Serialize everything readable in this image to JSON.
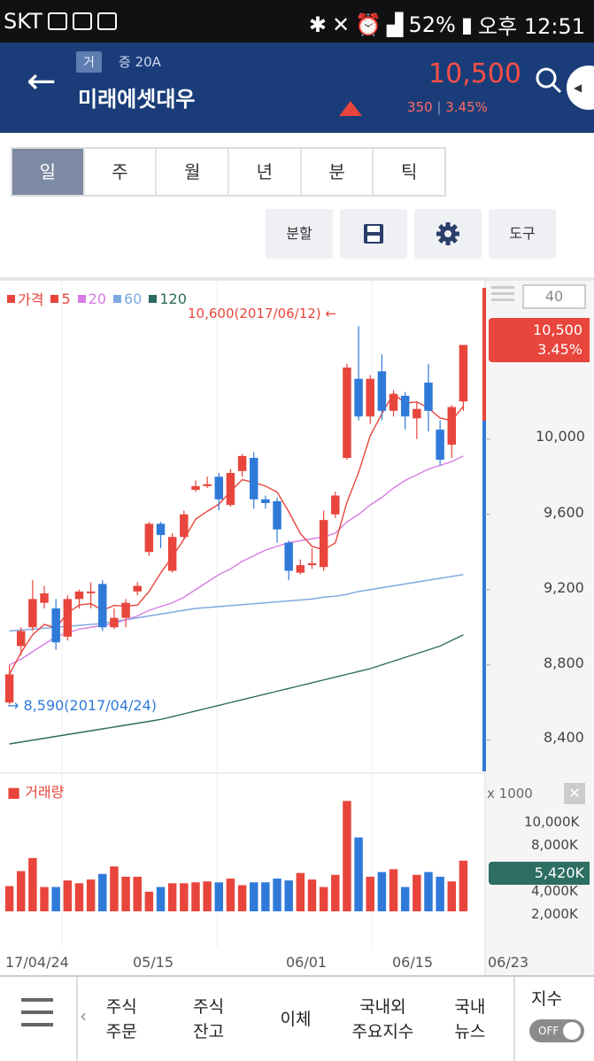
{
  "status_bar": {
    "carrier": "SKT",
    "battery": "52%",
    "time": "오후 12:51"
  },
  "header": {
    "tag": "거",
    "margin": "증 20A",
    "name": "미래에셋대우",
    "price": "10,500",
    "change_abs": "350",
    "change_pct": "3.45%"
  },
  "tabs": [
    "일",
    "주",
    "월",
    "년",
    "분",
    "틱"
  ],
  "tools": [
    "분할",
    "save-icon",
    "gear-icon",
    "도구"
  ],
  "chart": {
    "period_box": "40",
    "legend": [
      {
        "label": "가격",
        "color": "#e8453c"
      },
      {
        "label": "5",
        "color": "#e8453c"
      },
      {
        "label": "20",
        "color": "#d77ee3"
      },
      {
        "label": "60",
        "color": "#7ca8e0"
      },
      {
        "label": "120",
        "color": "#2f6b5f"
      }
    ],
    "high_note": "10,600(2017/06/12) ←",
    "low_note": "→ 8,590(2017/04/24)",
    "current_price": "10,500",
    "current_pct": "3.45%",
    "y_ticks": [
      "10,000",
      "9,600",
      "9,200",
      "8,800",
      "8,400"
    ],
    "volume_label": "거래량",
    "volume_unit": "x 1000",
    "volume_ticks": [
      "10,000K",
      "8,000K",
      "4,000K",
      "2,000K"
    ],
    "current_volume": "5,420K",
    "x_ticks": [
      "17/04/24",
      "05/15",
      "06/01",
      "06/15",
      "06/23"
    ]
  },
  "chart_data": {
    "type": "candlestick",
    "title": "",
    "xlabel": "",
    "ylabel": "",
    "ylim": [
      8300,
      10700
    ],
    "volume_ylim": [
      0,
      12500
    ],
    "candles": [
      {
        "o": 8600,
        "c": 8750,
        "h": 8800,
        "l": 8590,
        "v": 2700
      },
      {
        "o": 8900,
        "c": 8980,
        "h": 9000,
        "l": 8850,
        "v": 4300
      },
      {
        "o": 9000,
        "c": 9150,
        "h": 9250,
        "l": 8980,
        "v": 5700
      },
      {
        "o": 9130,
        "c": 9180,
        "h": 9220,
        "l": 9100,
        "v": 2600
      },
      {
        "o": 9100,
        "c": 8920,
        "h": 9150,
        "l": 8880,
        "v": 2600
      },
      {
        "o": 8950,
        "c": 9150,
        "h": 9170,
        "l": 8930,
        "v": 3300
      },
      {
        "o": 9150,
        "c": 9190,
        "h": 9200,
        "l": 9100,
        "v": 3000
      },
      {
        "o": 9190,
        "c": 9190,
        "h": 9240,
        "l": 9100,
        "v": 3400
      },
      {
        "o": 9230,
        "c": 9000,
        "h": 9250,
        "l": 8980,
        "v": 4000
      },
      {
        "o": 9000,
        "c": 9050,
        "h": 9100,
        "l": 8990,
        "v": 4800
      },
      {
        "o": 9050,
        "c": 9130,
        "h": 9150,
        "l": 9000,
        "v": 3700
      },
      {
        "o": 9190,
        "c": 9220,
        "h": 9240,
        "l": 9170,
        "v": 3700
      },
      {
        "o": 9400,
        "c": 9550,
        "h": 9560,
        "l": 9380,
        "v": 2100
      },
      {
        "o": 9550,
        "c": 9490,
        "h": 9560,
        "l": 9420,
        "v": 2600
      },
      {
        "o": 9300,
        "c": 9480,
        "h": 9500,
        "l": 9290,
        "v": 3000
      },
      {
        "o": 9480,
        "c": 9600,
        "h": 9620,
        "l": 9470,
        "v": 3000
      },
      {
        "o": 9730,
        "c": 9750,
        "h": 9780,
        "l": 9720,
        "v": 3100
      },
      {
        "o": 9750,
        "c": 9760,
        "h": 9800,
        "l": 9740,
        "v": 3200
      },
      {
        "o": 9800,
        "c": 9680,
        "h": 9820,
        "l": 9620,
        "v": 3100
      },
      {
        "o": 9650,
        "c": 9820,
        "h": 9840,
        "l": 9640,
        "v": 3500
      },
      {
        "o": 9830,
        "c": 9910,
        "h": 9920,
        "l": 9800,
        "v": 2800
      },
      {
        "o": 9900,
        "c": 9680,
        "h": 9930,
        "l": 9630,
        "v": 3100
      },
      {
        "o": 9680,
        "c": 9660,
        "h": 9700,
        "l": 9630,
        "v": 3100
      },
      {
        "o": 9670,
        "c": 9520,
        "h": 9690,
        "l": 9450,
        "v": 3500
      },
      {
        "o": 9450,
        "c": 9300,
        "h": 9460,
        "l": 9250,
        "v": 3300
      },
      {
        "o": 9290,
        "c": 9330,
        "h": 9360,
        "l": 9280,
        "v": 4100
      },
      {
        "o": 9330,
        "c": 9340,
        "h": 9420,
        "l": 9310,
        "v": 3400
      },
      {
        "o": 9320,
        "c": 9570,
        "h": 9620,
        "l": 9300,
        "v": 2600
      },
      {
        "o": 9600,
        "c": 9700,
        "h": 9720,
        "l": 9580,
        "v": 3900
      },
      {
        "o": 9900,
        "c": 10380,
        "h": 10400,
        "l": 9890,
        "v": 11800
      },
      {
        "o": 10320,
        "c": 10120,
        "h": 10600,
        "l": 10100,
        "v": 7900
      },
      {
        "o": 10120,
        "c": 10320,
        "h": 10340,
        "l": 10080,
        "v": 3700
      },
      {
        "o": 10360,
        "c": 10150,
        "h": 10450,
        "l": 10100,
        "v": 4200
      },
      {
        "o": 10150,
        "c": 10240,
        "h": 10260,
        "l": 10120,
        "v": 4500
      },
      {
        "o": 10230,
        "c": 10120,
        "h": 10250,
        "l": 10050,
        "v": 2600
      },
      {
        "o": 10110,
        "c": 10160,
        "h": 10200,
        "l": 10000,
        "v": 3900
      },
      {
        "o": 10300,
        "c": 10150,
        "h": 10400,
        "l": 10040,
        "v": 4200
      },
      {
        "o": 10050,
        "c": 9890,
        "h": 10100,
        "l": 9860,
        "v": 3700
      },
      {
        "o": 9970,
        "c": 10170,
        "h": 10180,
        "l": 9900,
        "v": 3200
      },
      {
        "o": 10200,
        "c": 10500,
        "h": 10500,
        "l": 10150,
        "v": 5420
      }
    ],
    "ma_20": [
      8800,
      8830,
      8870,
      8910,
      8950,
      8970,
      8990,
      9000,
      9010,
      9020,
      9040,
      9060,
      9090,
      9110,
      9130,
      9160,
      9200,
      9240,
      9280,
      9310,
      9350,
      9380,
      9410,
      9430,
      9450,
      9460,
      9470,
      9480,
      9500,
      9560,
      9600,
      9650,
      9690,
      9740,
      9780,
      9810,
      9840,
      9860,
      9880,
      9910
    ],
    "ma_60": [
      8980,
      8985,
      8990,
      8995,
      9000,
      9005,
      9010,
      9015,
      9020,
      9030,
      9040,
      9050,
      9060,
      9070,
      9080,
      9090,
      9100,
      9105,
      9110,
      9115,
      9120,
      9125,
      9130,
      9135,
      9140,
      9145,
      9150,
      9160,
      9165,
      9175,
      9190,
      9200,
      9210,
      9220,
      9230,
      9240,
      9250,
      9260,
      9270,
      9280
    ],
    "ma_120": [
      8380,
      8390,
      8400,
      8410,
      8420,
      8430,
      8440,
      8450,
      8460,
      8470,
      8480,
      8490,
      8500,
      8510,
      8525,
      8540,
      8555,
      8570,
      8585,
      8600,
      8615,
      8630,
      8645,
      8660,
      8675,
      8690,
      8705,
      8720,
      8735,
      8750,
      8765,
      8780,
      8800,
      8820,
      8840,
      8860,
      8880,
      8900,
      8930,
      8960
    ]
  },
  "bottom_nav": {
    "items": [
      "주식\n주문",
      "주식\n잔고",
      "이체",
      "국내외\n주요지수",
      "국내\n뉴스"
    ],
    "index_label": "지수",
    "toggle": "OFF"
  }
}
